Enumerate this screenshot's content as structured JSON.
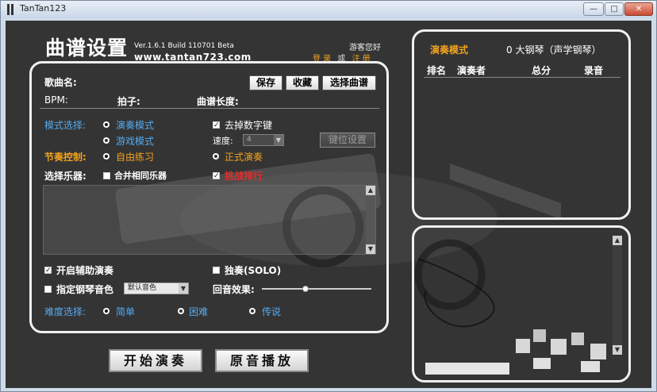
{
  "window": {
    "title": "TanTan123",
    "controls": {
      "minimize": "—",
      "maximize": "□",
      "close": "✕"
    }
  },
  "header": {
    "title": "曲谱设置",
    "version": "Ver.1.6.1 Build 110701 Beta",
    "site": "www.tantan723.com",
    "greeting": "游客您好",
    "login": "登 录",
    "or": "或",
    "register": "注 册"
  },
  "song": {
    "name_label": "歌曲名:",
    "bpm_label": "BPM:",
    "beat_label": "拍子:",
    "length_label": "曲谱长度:",
    "save": "保存",
    "favorite": "收藏",
    "choose": "选择曲谱"
  },
  "mode": {
    "label": "模式选择:",
    "perform": "演奏模式",
    "game": "游戏模式",
    "remove_numbers": "去掉数字键",
    "speed_label": "速度:",
    "speed_value": "4",
    "key_settings": "键位设置"
  },
  "rhythm": {
    "label": "节奏控制:",
    "free": "自由练习",
    "formal": "正式演奏"
  },
  "instrument": {
    "label": "选择乐器:",
    "merge": "合并相同乐器",
    "chart": "挑战排行"
  },
  "assist": {
    "enable": "开启辅助演奏",
    "solo": "独奏(SOLO)",
    "piano_color": "指定钢琴音色",
    "piano_value": "默认音色",
    "echo": "回音效果:",
    "echo_level": 0.4
  },
  "difficulty": {
    "label": "难度选择:",
    "easy": "简单",
    "hard": "困难",
    "legend": "传说"
  },
  "actions": {
    "start": "开始演奏",
    "original": "原音播放"
  },
  "ranking": {
    "mode_label": "演奏模式",
    "mode_value": "0 大钢琴（声学钢琴）",
    "columns": [
      "排名",
      "演奏者",
      "总分",
      "录音"
    ]
  },
  "colors": {
    "accent_blue": "#55aaf0",
    "accent_orange": "#f2a21c",
    "accent_red": "#e52b2b",
    "background": "#343434"
  }
}
